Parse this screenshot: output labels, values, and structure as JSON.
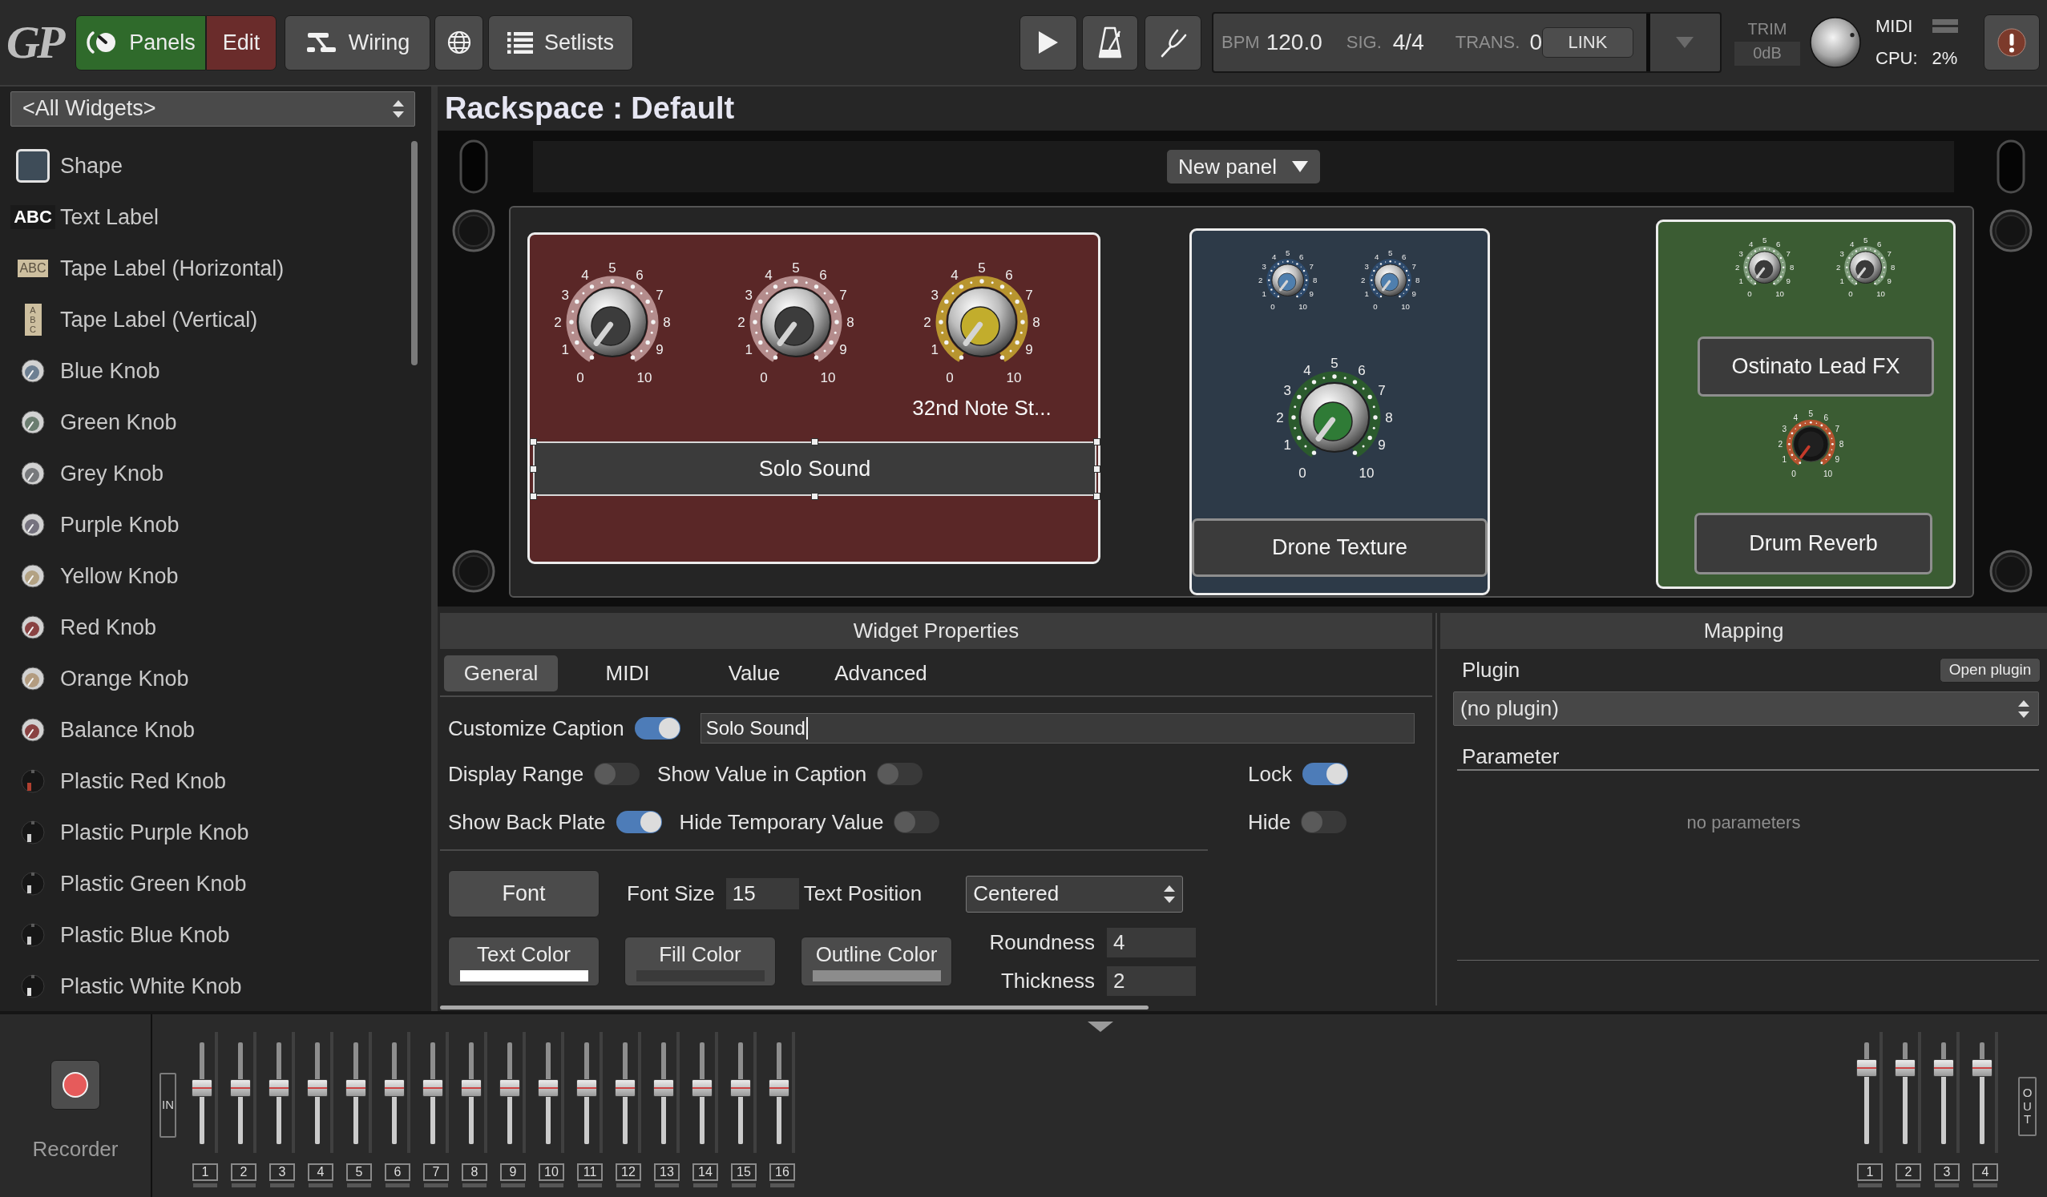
{
  "toolbar": {
    "logo": "GP",
    "panels": {
      "label": "Panels",
      "on": true
    },
    "edit": {
      "label": "Edit",
      "on": true
    },
    "views": [
      {
        "kind": "wiring",
        "label": "Wiring"
      },
      {
        "kind": "globe"
      },
      {
        "kind": "setlists",
        "label": "Setlists"
      }
    ],
    "transport": [
      {
        "kind": "play"
      },
      {
        "kind": "metronome"
      },
      {
        "kind": "tuner"
      }
    ],
    "tempo": {
      "bpm_label": "BPM",
      "bpm": "120.0",
      "sig_label": "SIG.",
      "sig": "4/4",
      "trans_label": "TRANS.",
      "trans": "0",
      "link": "LINK"
    },
    "trim": {
      "label": "TRIM",
      "value": "0dB"
    },
    "status": {
      "midi_label": "MIDI",
      "cpu_label": "CPU:",
      "cpu": "2%"
    }
  },
  "widget_list": {
    "filter": "<All Widgets>",
    "items": [
      {
        "kind": "shape",
        "label": "Shape",
        "color": "#3e4c58"
      },
      {
        "kind": "text-label",
        "label": "Text Label",
        "icon_text": "ABC"
      },
      {
        "kind": "tape-horizontal",
        "label": "Tape Label (Horizontal)",
        "icon_text": "ABC"
      },
      {
        "kind": "tape-vertical",
        "label": "Tape Label (Vertical)",
        "icon_text": "ABC"
      },
      {
        "kind": "knob",
        "label": "Blue Knob",
        "color": "#6d7f92"
      },
      {
        "kind": "knob",
        "label": "Green Knob",
        "color": "#6b7d70"
      },
      {
        "kind": "knob",
        "label": "Grey Knob",
        "color": "#77797c"
      },
      {
        "kind": "knob",
        "label": "Purple Knob",
        "color": "#76737f"
      },
      {
        "kind": "knob",
        "label": "Yellow Knob",
        "color": "#b3a283"
      },
      {
        "kind": "knob",
        "label": "Red Knob",
        "color": "#8a4343"
      },
      {
        "kind": "knob",
        "label": "Orange Knob",
        "color": "#b39c80"
      },
      {
        "kind": "knob",
        "label": "Balance Knob",
        "color": "#8a4343"
      },
      {
        "kind": "plastic-knob",
        "label": "Plastic Red Knob",
        "color": "#b04030"
      },
      {
        "kind": "plastic-knob",
        "label": "Plastic Purple Knob",
        "color": "#d0d0d0"
      },
      {
        "kind": "plastic-knob",
        "label": "Plastic Green Knob",
        "color": "#d0d0d0"
      },
      {
        "kind": "plastic-knob",
        "label": "Plastic Blue Knob",
        "color": "#d0d0d0"
      },
      {
        "kind": "plastic-knob",
        "label": "Plastic White Knob",
        "color": "#e0e0e0"
      }
    ]
  },
  "rackspace": {
    "title": "Rackspace : Default",
    "panel_menu": "New panel",
    "panels": [
      {
        "color": "#5a2727",
        "widgets": [
          {
            "kind": "knob",
            "color": "#3c3c3c",
            "ring": {
              "color": "#b48c8c"
            },
            "scale": [
              "0",
              "1",
              "2",
              "3",
              "4",
              "5",
              "6",
              "7",
              "8",
              "9",
              "10"
            ]
          },
          {
            "kind": "knob",
            "color": "#3c3c3c",
            "ring": {
              "color": "#b48c8c"
            },
            "scale": [
              "0",
              "1",
              "2",
              "3",
              "4",
              "5",
              "6",
              "7",
              "8",
              "9",
              "10"
            ]
          },
          {
            "kind": "knob",
            "color": "#c2ad2c",
            "ring": {
              "color": "#b8952f"
            },
            "scale": [
              "0",
              "1",
              "2",
              "3",
              "4",
              "5",
              "6",
              "7",
              "8",
              "9",
              "10"
            ],
            "caption": "32nd Note St..."
          },
          {
            "kind": "label",
            "text": "Solo Sound",
            "selected": true
          }
        ]
      },
      {
        "color": "#2d3a48",
        "widgets": [
          {
            "kind": "mini-knob",
            "color": "#4f7fae",
            "ring": {
              "color": "#2d4a6c"
            },
            "scale": [
              "0",
              "1",
              "2",
              "3",
              "4",
              "5",
              "6",
              "7",
              "8",
              "9",
              "10"
            ]
          },
          {
            "kind": "mini-knob",
            "color": "#4f7fae",
            "ring": {
              "color": "#2d4a6c"
            },
            "scale": [
              "0",
              "1",
              "2",
              "3",
              "4",
              "5",
              "6",
              "7",
              "8",
              "9",
              "10"
            ]
          },
          {
            "kind": "knob",
            "color": "#2f7b36",
            "ring": {
              "color": "#2b5a2d"
            },
            "scale": [
              "0",
              "1",
              "2",
              "3",
              "4",
              "5",
              "6",
              "7",
              "8",
              "9",
              "10"
            ]
          },
          {
            "kind": "label",
            "text": "Drone Texture",
            "selected": false
          }
        ]
      },
      {
        "color": "#3b5c33",
        "widgets": [
          {
            "kind": "mini-knob",
            "color": "#3a3a3a",
            "ring": {
              "color": "#7f9c7c"
            },
            "scale": [
              "0",
              "1",
              "2",
              "3",
              "4",
              "5",
              "6",
              "7",
              "8",
              "9",
              "10"
            ]
          },
          {
            "kind": "mini-knob",
            "color": "#3a3a3a",
            "ring": {
              "color": "#7f9c7c"
            },
            "scale": [
              "0",
              "1",
              "2",
              "3",
              "4",
              "5",
              "6",
              "7",
              "8",
              "9",
              "10"
            ]
          },
          {
            "kind": "label",
            "text": "Ostinato Lead FX",
            "selected": false
          },
          {
            "kind": "plastic-knob",
            "color": "#c43a2a",
            "ring": {
              "color": "#b5532f"
            },
            "scale": [
              "0",
              "1",
              "2",
              "3",
              "4",
              "5",
              "6",
              "7",
              "8",
              "9",
              "10"
            ]
          },
          {
            "kind": "label",
            "text": "Drum Reverb",
            "selected": false
          }
        ]
      }
    ]
  },
  "widget_properties": {
    "title": "Widget Properties",
    "tabs": [
      {
        "label": "General",
        "selected": true
      },
      {
        "label": "MIDI",
        "selected": false
      },
      {
        "label": "Value",
        "selected": false
      },
      {
        "label": "Advanced",
        "selected": false
      }
    ],
    "caption": {
      "label": "Customize Caption",
      "on": true,
      "value": "Solo Sound",
      "editing": true
    },
    "toggle_rows": [
      {
        "toggles": [
          {
            "label": "Display Range",
            "on": false
          },
          {
            "label": "Show Value in Caption",
            "on": false
          },
          {
            "label": "Lock",
            "on": true
          }
        ]
      },
      {
        "toggles": [
          {
            "label": "Show Back Plate",
            "on": true
          },
          {
            "label": "Hide Temporary Value",
            "on": false
          },
          {
            "label": "Hide",
            "on": false
          }
        ]
      }
    ],
    "font": {
      "button": "Font",
      "size_label": "Font Size",
      "size": "15",
      "position_label": "Text Position",
      "position": "Centered"
    },
    "color_buttons": [
      {
        "label": "Text Color",
        "color": "#ffffff"
      },
      {
        "label": "Fill Color",
        "color": "#3a3a3a"
      },
      {
        "label": "Outline Color",
        "color": "#8c8c8c"
      }
    ],
    "shape": [
      {
        "label": "Roundness",
        "value": "4"
      },
      {
        "label": "Thickness",
        "value": "2"
      }
    ]
  },
  "mapping": {
    "title": "Mapping",
    "plugin_label": "Plugin",
    "open_plugin": "Open plugin",
    "plugin": "(no plugin)",
    "parameter_label": "Parameter",
    "empty": "no parameters"
  },
  "mixer": {
    "recorder": "Recorder",
    "inputs": {
      "label": "IN",
      "channels": [
        {
          "number": "1",
          "level": 0.55
        },
        {
          "number": "2",
          "level": 0.55
        },
        {
          "number": "3",
          "level": 0.55
        },
        {
          "number": "4",
          "level": 0.55
        },
        {
          "number": "5",
          "level": 0.55
        },
        {
          "number": "6",
          "level": 0.55
        },
        {
          "number": "7",
          "level": 0.55
        },
        {
          "number": "8",
          "level": 0.55
        },
        {
          "number": "9",
          "level": 0.55
        },
        {
          "number": "10",
          "level": 0.55
        },
        {
          "number": "11",
          "level": 0.55
        },
        {
          "number": "12",
          "level": 0.55
        },
        {
          "number": "13",
          "level": 0.55
        },
        {
          "number": "14",
          "level": 0.55
        },
        {
          "number": "15",
          "level": 0.55
        },
        {
          "number": "16",
          "level": 0.55
        }
      ]
    },
    "outputs": {
      "label": "OUT",
      "channels": [
        {
          "number": "1",
          "level": 0.75
        },
        {
          "number": "2",
          "level": 0.75
        },
        {
          "number": "3",
          "level": 0.75
        },
        {
          "number": "4",
          "level": 0.75
        }
      ]
    }
  }
}
